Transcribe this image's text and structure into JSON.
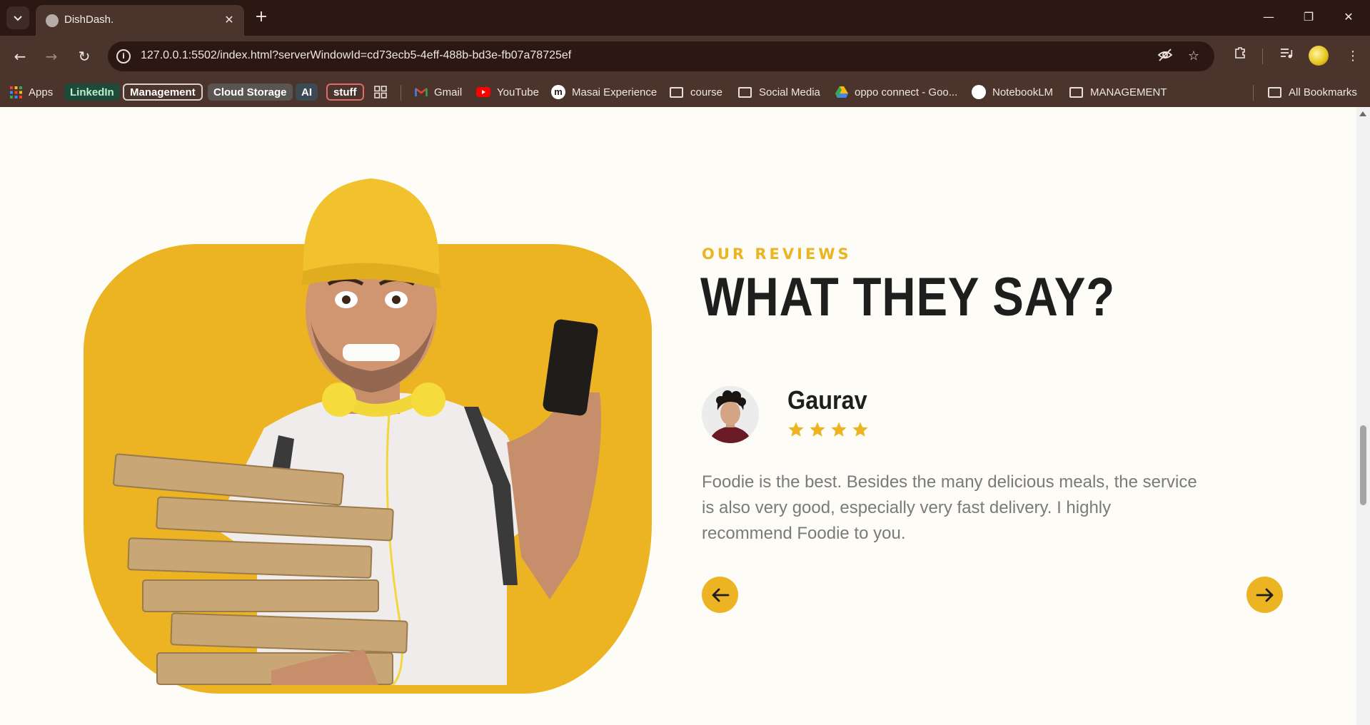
{
  "browser": {
    "tab_title": "DishDash.",
    "url": "127.0.0.1:5502/index.html?serverWindowId=cd73ecb5-4eff-488b-bd3e-fb07a78725ef",
    "bookmarks": [
      {
        "label": "Apps",
        "type": "apps"
      },
      {
        "label": "LinkedIn",
        "type": "chip",
        "bg": "#1f4a3a",
        "color": "#b7f0d0"
      },
      {
        "label": "Management",
        "type": "chip-outline",
        "bg": "#4a342b",
        "color": "#ffffff"
      },
      {
        "label": "Cloud Storage",
        "type": "chip",
        "bg": "#5a5552",
        "color": "#ffffff"
      },
      {
        "label": "AI",
        "type": "chip",
        "bg": "#3c4a55",
        "color": "#ffffff"
      },
      {
        "label": "stuff",
        "type": "chip-red",
        "bg": "#4a342b",
        "color": "#ffffff"
      },
      {
        "label": "Gmail",
        "type": "gmail"
      },
      {
        "label": "YouTube",
        "type": "youtube"
      },
      {
        "label": "Masai Experience",
        "type": "masai"
      },
      {
        "label": "course",
        "type": "folder"
      },
      {
        "label": "Social Media",
        "type": "folder"
      },
      {
        "label": "oppo connect - Goo...",
        "type": "drive"
      },
      {
        "label": "NotebookLM",
        "type": "notebook"
      },
      {
        "label": "MANAGEMENT",
        "type": "folder"
      }
    ],
    "all_bookmarks": "All Bookmarks"
  },
  "reviews": {
    "eyebrow": "OUR REVIEWS",
    "headline": "WHAT THEY SAY?",
    "reviewer_name": "Gaurav",
    "rating": 4,
    "text": "Foodie is the best. Besides the many delicious meals, the service is also very good, especially very fast delivery. I highly recommend Foodie to you."
  },
  "colors": {
    "accent": "#ecb423",
    "heading": "#1e1e1e",
    "body_text": "#7a7a7a",
    "page_bg": "#fefcf6",
    "chrome_dark": "#2b1812",
    "chrome": "#4a342b"
  },
  "icons": {
    "prev": "arrow-left-icon",
    "next": "arrow-right-icon",
    "star": "star-icon"
  }
}
